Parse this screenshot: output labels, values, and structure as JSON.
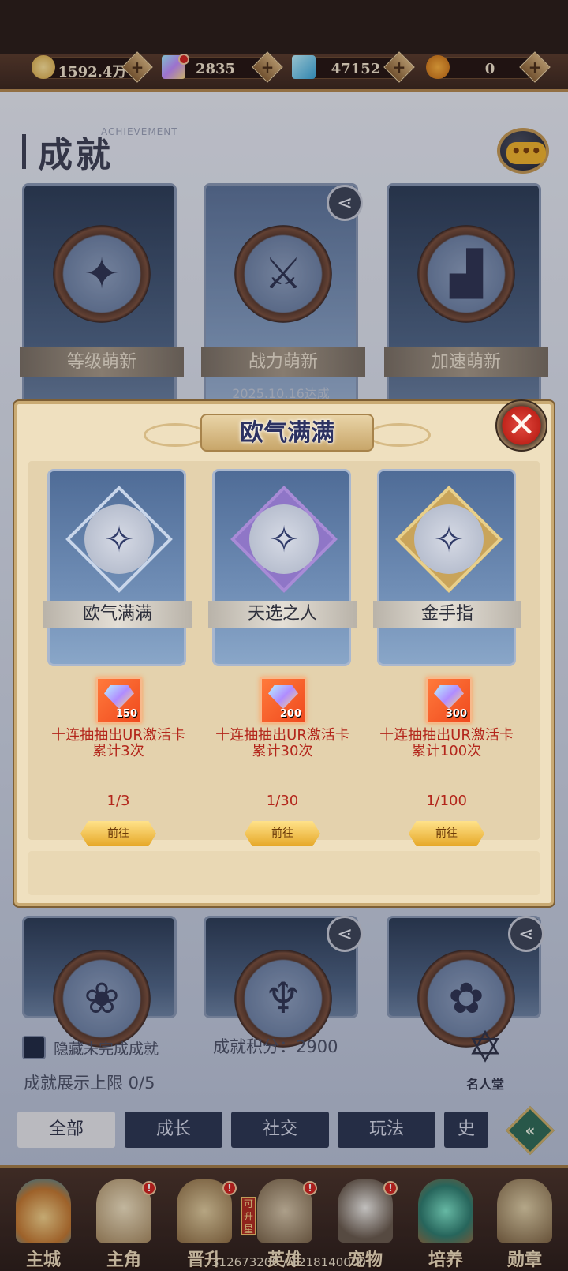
{
  "resources": [
    {
      "icon": "gold-coin-icon",
      "value": "1592.4万"
    },
    {
      "icon": "rainbow-gem-icon",
      "value": "2835"
    },
    {
      "icon": "blue-crystal-icon",
      "value": "47152"
    },
    {
      "icon": "token-icon",
      "value": "0"
    }
  ],
  "page": {
    "title": "成就",
    "subtitle": "ACHIEVEMENT"
  },
  "background_cards": [
    {
      "label": "等级萌新",
      "icon": "level-emblem-icon"
    },
    {
      "label": "战力萌新",
      "icon": "crossed-swords-icon",
      "date": "2025.10.16达成"
    },
    {
      "label": "加速萌新",
      "icon": "boots-icon"
    }
  ],
  "modal": {
    "title": "欧气满满",
    "close_icon": "close-icon",
    "achievements": [
      {
        "name": "欧气满满",
        "reward_count": "150",
        "desc_line1": "十连抽抽出UR激活卡",
        "desc_line2": "累计3次",
        "progress": "1/3",
        "progress_value": 0.333,
        "button": "前往"
      },
      {
        "name": "天选之人",
        "reward_count": "200",
        "desc_line1": "十连抽抽出UR激活卡",
        "desc_line2": "累计30次",
        "progress": "1/30",
        "progress_value": 0.033,
        "button": "前往"
      },
      {
        "name": "金手指",
        "reward_count": "300",
        "desc_line1": "十连抽抽出UR激活卡",
        "desc_line2": "累计100次",
        "progress": "1/100",
        "progress_value": 0.01,
        "button": "前往"
      }
    ]
  },
  "footer_controls": {
    "hide_incomplete_label": "隐藏未完成成就",
    "score_label": "成就积分：2900",
    "display_limit_label": "成就展示上限 0/5",
    "hall_of_fame_label": "名人堂"
  },
  "tabs": [
    "全部",
    "成长",
    "社交",
    "玩法",
    "史"
  ],
  "bottom_nav": [
    {
      "label": "主城",
      "badge": false
    },
    {
      "label": "主角",
      "badge": true
    },
    {
      "label": "晋升",
      "badge": true
    },
    {
      "label": "英雄",
      "badge": true,
      "tag": "可升星"
    },
    {
      "label": "宠物",
      "badge": true
    },
    {
      "label": "培养",
      "badge": false
    },
    {
      "label": "勋章",
      "badge": false
    }
  ],
  "footer_text": "312673200 / 1218140000",
  "colors": {
    "accent_red": "#b3261b",
    "modal_bg": "#efe0bf",
    "card_blue": "#6f8db5",
    "title_navy": "#2d3262"
  }
}
